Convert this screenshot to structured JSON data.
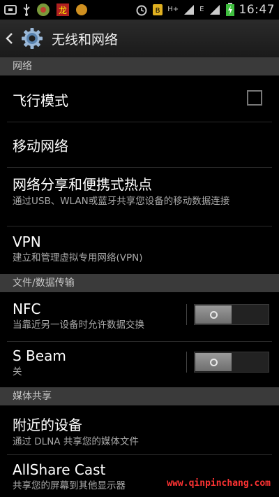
{
  "status_bar": {
    "time": "16:47",
    "network_label": "H+",
    "network_label2": "E",
    "icons": [
      "usb-icon",
      "download-icon",
      "app-icon",
      "app-icon-2",
      "app-icon-3",
      "alarm-icon",
      "notification-icon",
      "signal-icon",
      "battery-charging-icon"
    ]
  },
  "action_bar": {
    "title": "无线和网络"
  },
  "sections": {
    "network": "网络",
    "file_transfer": "文件/数据传输",
    "media_share": "媒体共享"
  },
  "items": {
    "airplane": {
      "title": "飞行模式",
      "checked": false
    },
    "mobile_network": {
      "title": "移动网络"
    },
    "tethering": {
      "title": "网络分享和便携式热点",
      "subtitle": "通过USB、WLAN或蓝牙共享您设备的移动数据连接"
    },
    "vpn": {
      "title": "VPN",
      "subtitle": "建立和管理虚拟专用网络(VPN)"
    },
    "nfc": {
      "title": "NFC",
      "subtitle": "当靠近另一设备时允许数据交换",
      "enabled": false
    },
    "sbeam": {
      "title": "S Beam",
      "subtitle": "关",
      "enabled": false
    },
    "nearby": {
      "title": "附近的设备",
      "subtitle": "通过 DLNA 共享您的媒体文件"
    },
    "allshare": {
      "title": "AllShare Cast",
      "subtitle": "共享您的屏幕到其他显示器"
    }
  },
  "watermark": "www.qinpinchang.com",
  "colors": {
    "accent": "#2a6aa0",
    "section_bg": "#3a3a3a",
    "watermark": "#ff3333"
  }
}
